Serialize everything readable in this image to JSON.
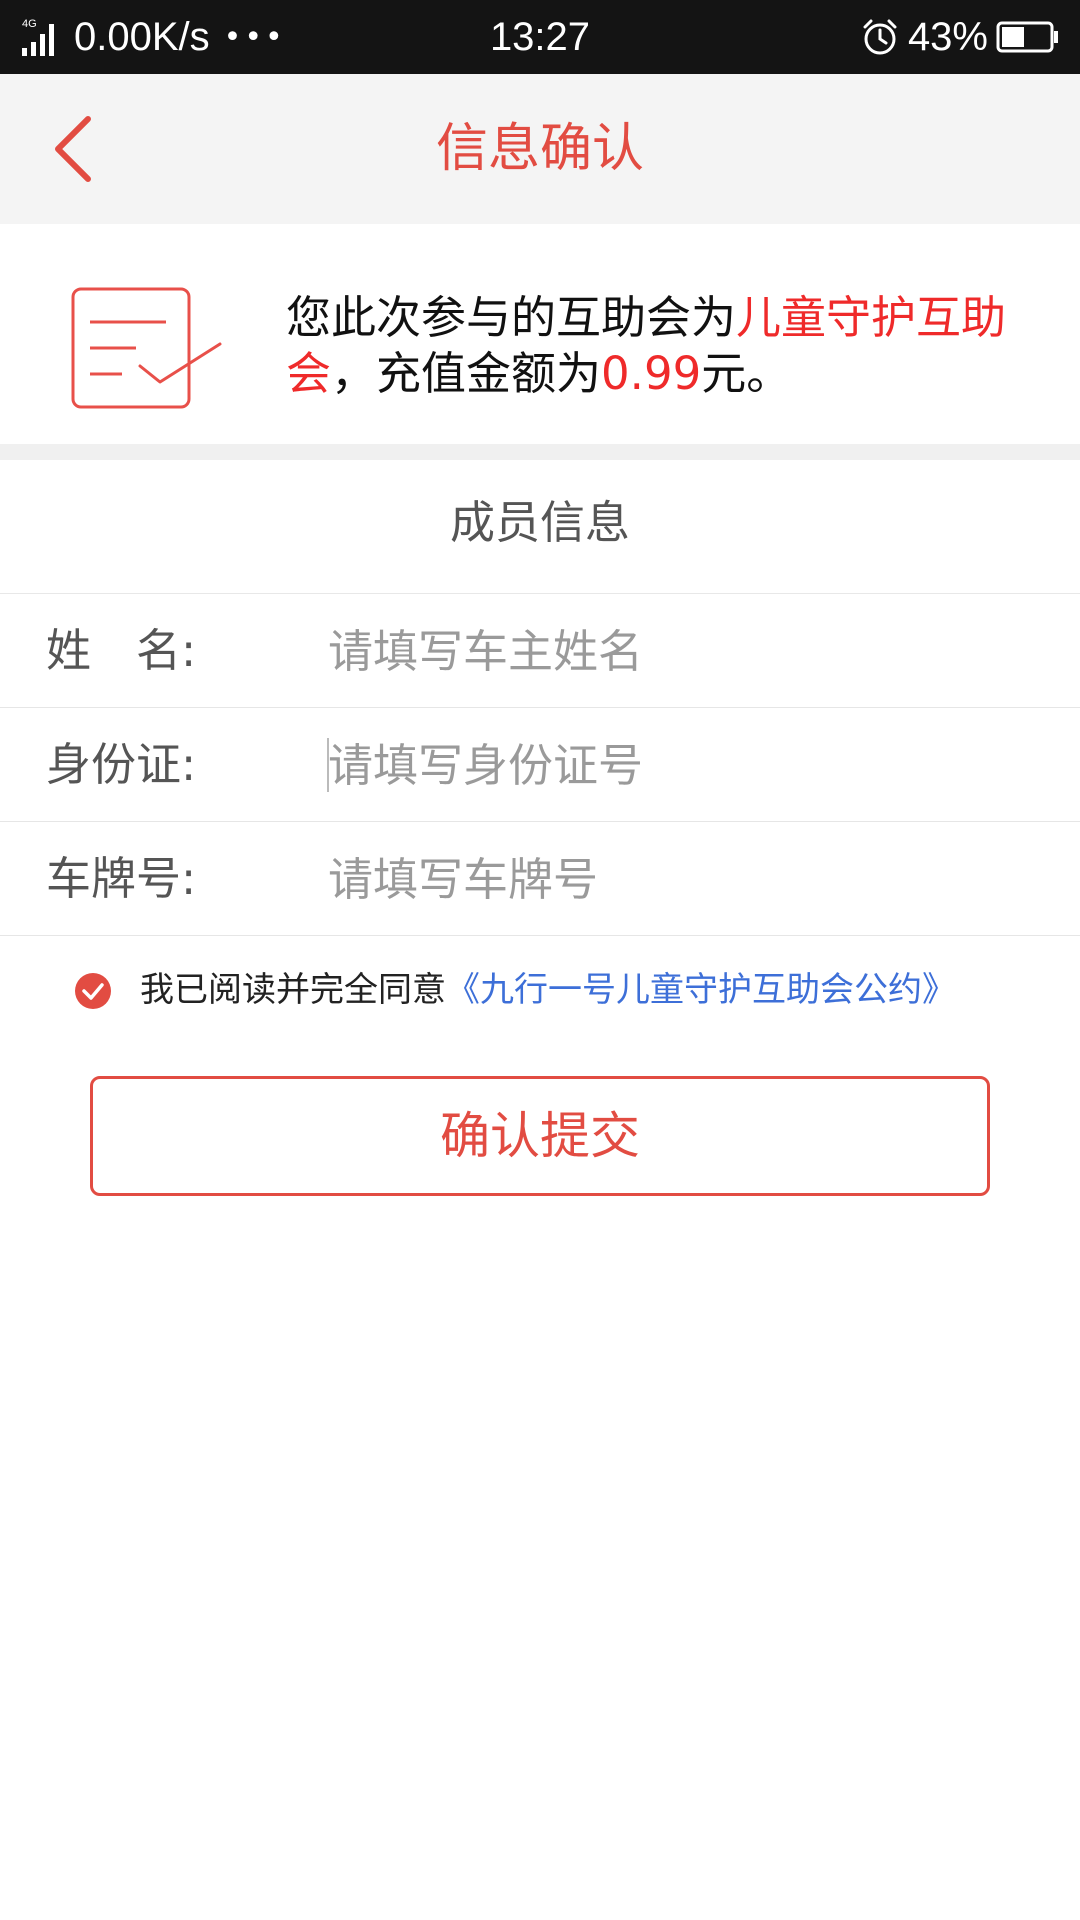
{
  "status_bar": {
    "network": "4G",
    "speed": "0.00K/s",
    "dots": "•••",
    "time": "13:27",
    "battery": "43%",
    "icons": [
      "signal-icon",
      "alarm-icon",
      "battery-icon"
    ]
  },
  "header": {
    "title": "信息确认",
    "back_icon": "chevron-left-icon"
  },
  "info": {
    "text_prefix": "您此次参与的互助会为",
    "org_name": "儿童守护互助会",
    "text_middle": "，充值金额为",
    "amount": "0.99",
    "text_suffix": "元。",
    "icon": "document-check-icon"
  },
  "section": {
    "title": "成员信息"
  },
  "form": {
    "fields": [
      {
        "label": "姓　名:",
        "placeholder": "请填写车主姓名",
        "value": ""
      },
      {
        "label": "身份证:",
        "placeholder": "请填写身份证号",
        "value": ""
      },
      {
        "label": "车牌号:",
        "placeholder": "请填写车牌号",
        "value": ""
      }
    ]
  },
  "agreement": {
    "checked": true,
    "text": "我已阅读并完全同意",
    "link": "《九行一号儿童守护互助会公约》"
  },
  "submit": {
    "label": "确认提交"
  },
  "colors": {
    "accent": "#e24c42",
    "highlight": "#ef2a2a",
    "link": "#3d6fd8",
    "status_bar": "#141414"
  }
}
